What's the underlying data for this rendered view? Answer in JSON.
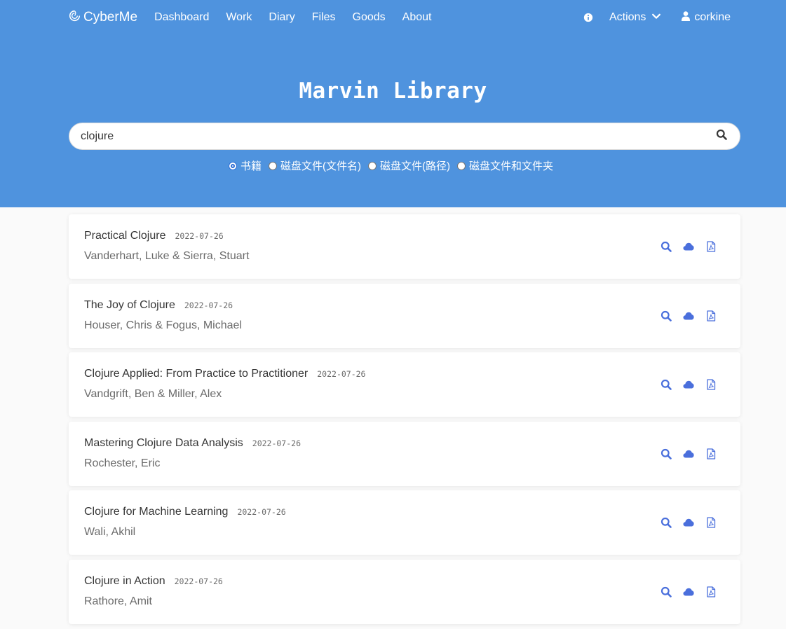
{
  "nav": {
    "brand": "CyberMe",
    "links": [
      "Dashboard",
      "Work",
      "Diary",
      "Files",
      "Goods",
      "About"
    ],
    "actions_label": "Actions",
    "user_label": "corkine"
  },
  "hero": {
    "title": "Marvin Library"
  },
  "search": {
    "value": "clojure"
  },
  "radios": [
    {
      "label": "书籍",
      "checked": true
    },
    {
      "label": "磁盘文件(文件名)",
      "checked": false
    },
    {
      "label": "磁盘文件(路径)",
      "checked": false
    },
    {
      "label": "磁盘文件和文件夹",
      "checked": false
    }
  ],
  "results": [
    {
      "title": "Practical Clojure",
      "date": "2022-07-26",
      "author": "Vanderhart, Luke & Sierra, Stuart"
    },
    {
      "title": "The Joy of Clojure",
      "date": "2022-07-26",
      "author": "Houser, Chris & Fogus, Michael"
    },
    {
      "title": "Clojure Applied: From Practice to Practitioner",
      "date": "2022-07-26",
      "author": "Vandgrift, Ben & Miller, Alex"
    },
    {
      "title": "Mastering Clojure Data Analysis",
      "date": "2022-07-26",
      "author": "Rochester, Eric"
    },
    {
      "title": "Clojure for Machine Learning",
      "date": "2022-07-26",
      "author": "Wali, Akhil"
    },
    {
      "title": "Clojure in Action",
      "date": "2022-07-26",
      "author": "Rathore, Amit"
    }
  ],
  "colors": {
    "hero_bg": "#4f93de",
    "icon_blue": "#4a6fdc"
  },
  "icons": {
    "brand": "brand-swirl-icon",
    "info": "info-circle-icon",
    "actions": "chevron-down-icon",
    "user": "user-icon",
    "search": "search-icon",
    "card": [
      "search-icon",
      "cloud-icon",
      "pdf-file-icon"
    ]
  }
}
